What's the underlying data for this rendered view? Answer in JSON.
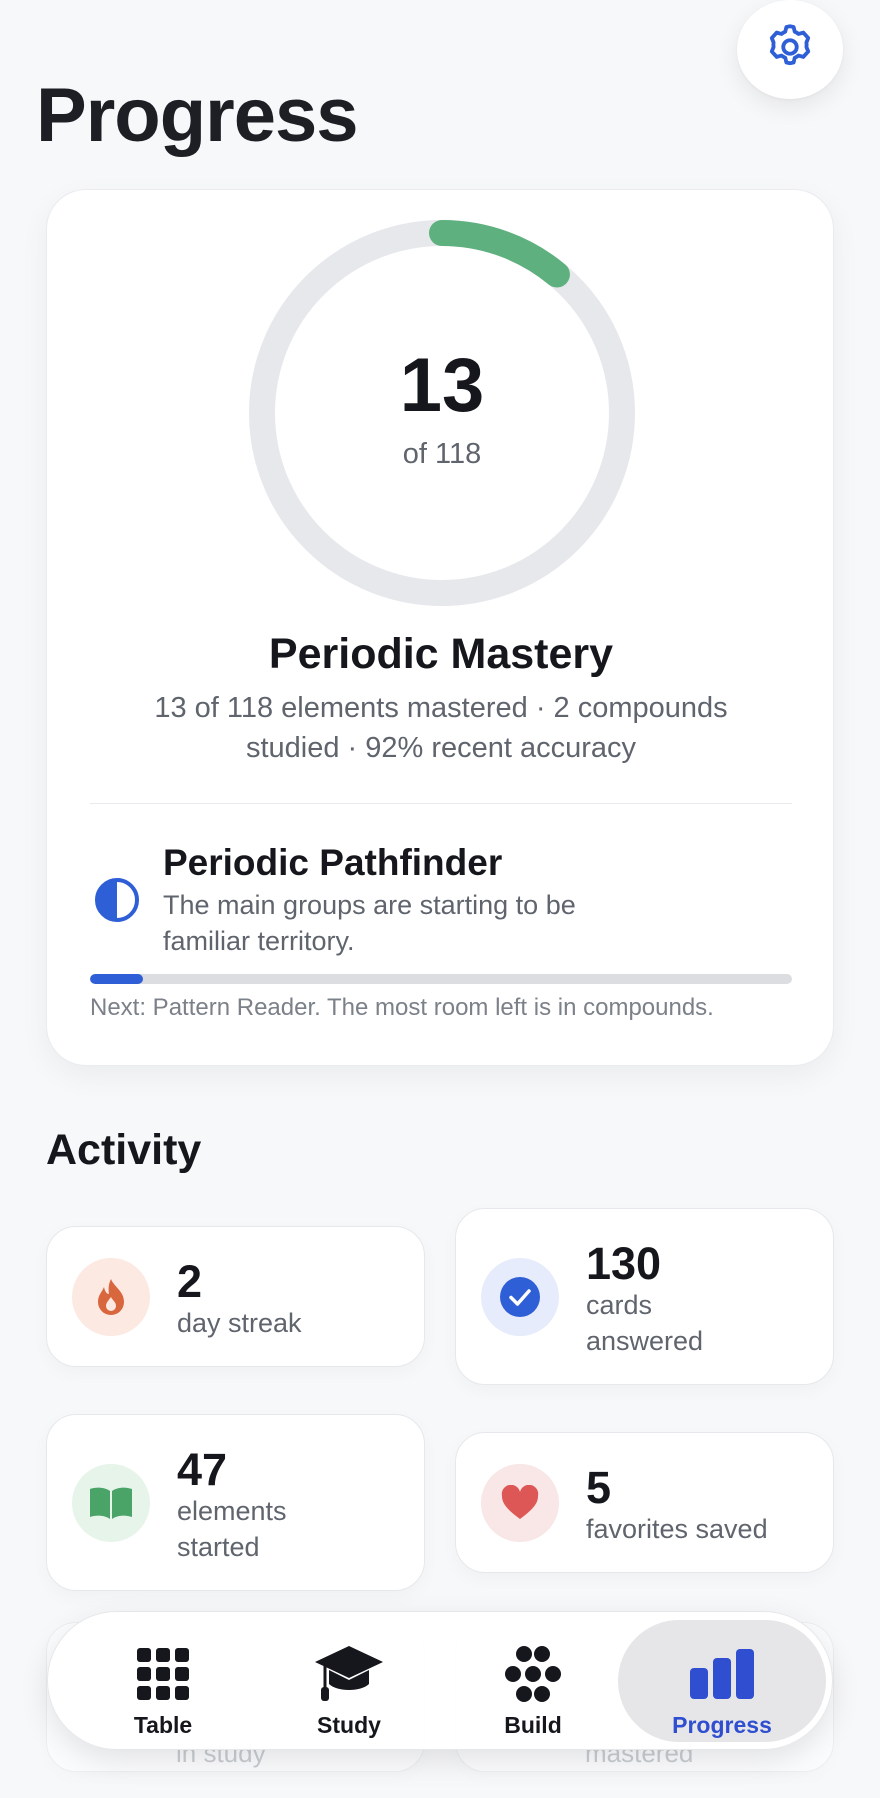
{
  "header": {
    "title": "Progress",
    "settings_icon": "gear-icon"
  },
  "mastery": {
    "value": "13",
    "caption": "of 118",
    "mastered": 13,
    "total": 118,
    "title": "Periodic Mastery",
    "summary": "13 of 118 elements mastered · 2 compounds studied · 92% recent accuracy",
    "ring_color": "#5fb07f",
    "track_color": "#e6e8ec"
  },
  "rank": {
    "icon": "half-circle-icon",
    "title": "Periodic Pathfinder",
    "description": "The main groups are starting to be familiar territory.",
    "progress_fraction": 0.075,
    "progress_color": "#2f5fd7",
    "next": "Next: Pattern Reader. The most room left is in compounds."
  },
  "activity": {
    "title": "Activity",
    "stats": [
      {
        "icon": "flame-icon",
        "value": "2",
        "label": "day streak",
        "icon_bg": "#fbe9e2",
        "icon_color": "#d9673d"
      },
      {
        "icon": "check-circle-icon",
        "value": "130",
        "label": "cards answered",
        "icon_bg": "#e6ecfb",
        "icon_color": "#2f5fd7"
      },
      {
        "icon": "book-icon",
        "value": "47",
        "label": "elements started",
        "icon_bg": "#e6f4ea",
        "icon_color": "#4aa367"
      },
      {
        "icon": "heart-icon",
        "value": "5",
        "label": "favorites saved",
        "icon_bg": "#f9e6e6",
        "icon_color": "#dd5757"
      }
    ],
    "peek_left": "in study",
    "peek_right": "mastered"
  },
  "nav": {
    "items": [
      {
        "label": "Table",
        "icon": "grid-icon"
      },
      {
        "label": "Study",
        "icon": "graduation-cap-icon"
      },
      {
        "label": "Build",
        "icon": "molecule-icon"
      },
      {
        "label": "Progress",
        "icon": "bar-chart-icon"
      }
    ],
    "active": "Progress",
    "active_color": "#2f4fd0"
  }
}
